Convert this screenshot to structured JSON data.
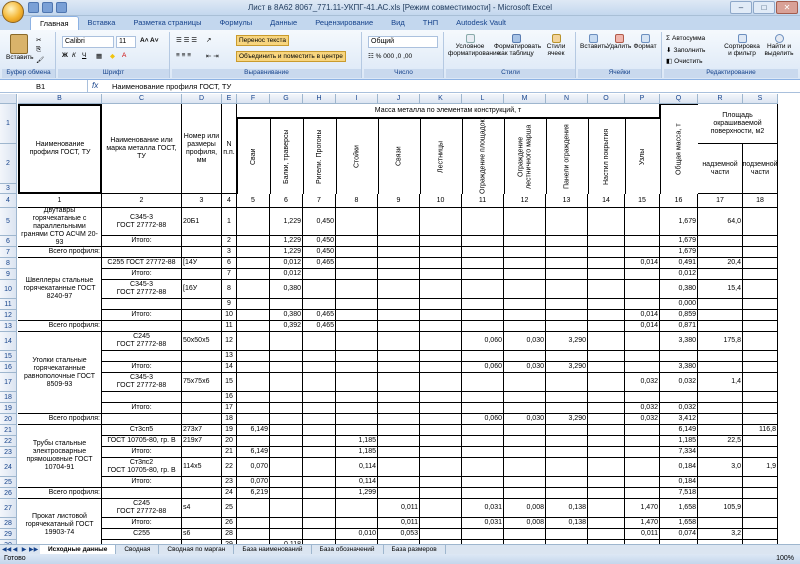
{
  "window": {
    "title": "Лист в 8А62 8067_771.11-УКПГ-41.АС.xls [Режим совместимости] - Microsoft Excel"
  },
  "ribbon": {
    "tabs": [
      "Главная",
      "Вставка",
      "Разметка страницы",
      "Формулы",
      "Данные",
      "Рецензирование",
      "Вид",
      "ТНП",
      "Autodesk Vault"
    ],
    "clipboard": {
      "paste": "Вставить",
      "group": "Буфер обмена"
    },
    "font": {
      "name": "Calibri",
      "size": "11",
      "group": "Шрифт"
    },
    "alignment": {
      "wrap": "Перенос текста",
      "merge": "Объединить и поместить в центре",
      "group": "Выравнивание"
    },
    "number": {
      "format": "Общий",
      "group": "Число"
    },
    "styles": {
      "cond": "Условное форматирование",
      "astable": "Форматировать как таблицу",
      "cellstyles": "Стили ячеек",
      "group": "Стили"
    },
    "cells": {
      "insert": "Вставить",
      "delete": "Удалить",
      "format": "Формат",
      "group": "Ячейки"
    },
    "editing": {
      "autosum": "Автосумма",
      "fill": "Заполнить",
      "clear": "Очистить",
      "sort": "Сортировка и фильтр",
      "find": "Найти и выделить",
      "group": "Редактирование"
    }
  },
  "formula_bar": {
    "name_box": "B1",
    "fx": "fx",
    "value": "Наименование профиля ГОСТ, ТУ"
  },
  "sheet": {
    "columns": [
      "B",
      "C",
      "D",
      "E",
      "F",
      "G",
      "H",
      "I",
      "J",
      "K",
      "L",
      "M",
      "N",
      "O",
      "P",
      "Q",
      "R",
      "S"
    ],
    "header": {
      "name": "Наименование профиля ГОСТ, ТУ",
      "brand": "Наименование или марка металла ГОСТ, ТУ",
      "size": "Номер или размеры профиля, мм",
      "num": "N п.п.",
      "mass_title": "Масса металла по элементам конструкций, т",
      "elements": [
        "Сваи",
        "Балки, траверсы",
        "Ригели. Прогоны",
        "Стойки",
        "Связи",
        "Лестницы",
        "Ограждение площадок",
        "Ограждение лестничного марша",
        "Панели ограждения",
        "Настил покрытия",
        "Узлы"
      ],
      "total": "Общая масса, т",
      "paint": "Площадь окрашиваемой поверхности, м2",
      "paint_above": "надземной части",
      "paint_under": "подземной части"
    },
    "colnums": [
      "1",
      "2",
      "3",
      "4",
      "5",
      "6",
      "7",
      "8",
      "9",
      "10",
      "11",
      "12",
      "13",
      "14",
      "15",
      "16",
      "17",
      "18"
    ],
    "rows": [
      {
        "r": "5",
        "b": "",
        "c": "С345-3\nГОСТ 27772-88",
        "d": "20Б1",
        "e": "1",
        "v": [
          "",
          "1,229",
          "0,450",
          "",
          "",
          "",
          "",
          "",
          "",
          "",
          "",
          "1,679",
          "64,0",
          ""
        ]
      },
      {
        "r": "6",
        "b": "",
        "c": "Итого:",
        "d": "",
        "e": "2",
        "v": [
          "",
          "1,229",
          "0,450",
          "",
          "",
          "",
          "",
          "",
          "",
          "",
          "",
          "1,679",
          "",
          ""
        ]
      },
      {
        "r": "7",
        "b": "Всего профиля:",
        "c": "",
        "d": "",
        "e": "3",
        "v": [
          "",
          "1,229",
          "0,450",
          "",
          "",
          "",
          "",
          "",
          "",
          "",
          "",
          "1,679",
          "",
          ""
        ]
      },
      {
        "r": "8",
        "b": "",
        "c": "С255 ГОСТ 27772-88",
        "d": "[14У",
        "e": "6",
        "v": [
          "",
          "0,012",
          "0,465",
          "",
          "",
          "",
          "",
          "",
          "",
          "",
          "0,014",
          "0,491",
          "20,4",
          ""
        ]
      },
      {
        "r": "9",
        "b": "",
        "c": "Итого:",
        "d": "",
        "e": "7",
        "v": [
          "",
          "0,012",
          "",
          "",
          "",
          "",
          "",
          "",
          "",
          "",
          "",
          "0,012",
          "",
          ""
        ]
      },
      {
        "r": "10",
        "b": "",
        "c": "С345-3\nГОСТ 27772-88",
        "d": "[16У",
        "e": "8",
        "v": [
          "",
          "0,380",
          "",
          "",
          "",
          "",
          "",
          "",
          "",
          "",
          "",
          "0,380",
          "15,4",
          ""
        ]
      },
      {
        "r": "11",
        "b": "",
        "c": "",
        "d": "",
        "e": "9",
        "v": [
          "",
          "",
          "",
          "",
          "",
          "",
          "",
          "",
          "",
          "",
          "",
          "0,000",
          "",
          ""
        ]
      },
      {
        "r": "12",
        "b": "",
        "c": "Итого:",
        "d": "",
        "e": "10",
        "v": [
          "",
          "0,380",
          "0,465",
          "",
          "",
          "",
          "",
          "",
          "",
          "",
          "0,014",
          "0,859",
          "",
          ""
        ]
      },
      {
        "r": "13",
        "b": "Всего профиля:",
        "c": "",
        "d": "",
        "e": "11",
        "v": [
          "",
          "0,392",
          "0,465",
          "",
          "",
          "",
          "",
          "",
          "",
          "",
          "0,014",
          "0,871",
          "",
          ""
        ]
      },
      {
        "r": "14",
        "b": "",
        "c": "С245\nГОСТ 27772-88",
        "d": "50х50х5",
        "e": "12",
        "v": [
          "",
          "",
          "",
          "",
          "",
          "",
          "0,060",
          "0,030",
          "3,290",
          "",
          "",
          "3,380",
          "175,8",
          ""
        ]
      },
      {
        "r": "15",
        "b": "",
        "c": "",
        "d": "",
        "e": "13",
        "v": [
          "",
          "",
          "",
          "",
          "",
          "",
          "",
          "",
          "",
          "",
          "",
          "",
          "",
          ""
        ]
      },
      {
        "r": "16",
        "b": "",
        "c": "Итого:",
        "d": "",
        "e": "14",
        "v": [
          "",
          "",
          "",
          "",
          "",
          "",
          "0,060",
          "0,030",
          "3,290",
          "",
          "",
          "3,380",
          "",
          ""
        ]
      },
      {
        "r": "17",
        "b": "",
        "c": "С345-3\nГОСТ 27772-88",
        "d": "75х75х6",
        "e": "15",
        "v": [
          "",
          "",
          "",
          "",
          "",
          "",
          "",
          "",
          "",
          "",
          "0,032",
          "0,032",
          "1,4",
          ""
        ]
      },
      {
        "r": "18",
        "b": "",
        "c": "",
        "d": "",
        "e": "16",
        "v": [
          "",
          "",
          "",
          "",
          "",
          "",
          "",
          "",
          "",
          "",
          "",
          "",
          "",
          ""
        ]
      },
      {
        "r": "19",
        "b": "",
        "c": "Итого:",
        "d": "",
        "e": "17",
        "v": [
          "",
          "",
          "",
          "",
          "",
          "",
          "",
          "",
          "",
          "",
          "0,032",
          "0,032",
          "",
          ""
        ]
      },
      {
        "r": "20",
        "b": "Всего профиля:",
        "c": "",
        "d": "",
        "e": "18",
        "v": [
          "",
          "",
          "",
          "",
          "",
          "",
          "0,060",
          "0,030",
          "3,290",
          "",
          "0,032",
          "3,412",
          "",
          ""
        ]
      },
      {
        "r": "21",
        "b": "",
        "c": "Ст3сп5",
        "d": "273х7",
        "e": "19",
        "v": [
          "6,149",
          "",
          "",
          "",
          "",
          "",
          "",
          "",
          "",
          "",
          "",
          "6,149",
          "",
          "116,8"
        ]
      },
      {
        "r": "22",
        "b": "",
        "c": "ГОСТ 10705-80, гр. В",
        "d": "219х7",
        "e": "20",
        "v": [
          "",
          "",
          "",
          "1,185",
          "",
          "",
          "",
          "",
          "",
          "",
          "",
          "1,185",
          "22,5",
          ""
        ]
      },
      {
        "r": "23",
        "b": "",
        "c": "Итого:",
        "d": "",
        "e": "21",
        "v": [
          "6,149",
          "",
          "",
          "1,185",
          "",
          "",
          "",
          "",
          "",
          "",
          "",
          "7,334",
          "",
          ""
        ]
      },
      {
        "r": "24",
        "b": "",
        "c": "Ст3пс2\nГОСТ 10705-80, гр. В",
        "d": "114х5",
        "e": "22",
        "v": [
          "0,070",
          "",
          "",
          "0,114",
          "",
          "",
          "",
          "",
          "",
          "",
          "",
          "0,184",
          "3,0",
          "1,9"
        ]
      },
      {
        "r": "25",
        "b": "",
        "c": "Итого:",
        "d": "",
        "e": "23",
        "v": [
          "0,070",
          "",
          "",
          "0,114",
          "",
          "",
          "",
          "",
          "",
          "",
          "",
          "0,184",
          "",
          ""
        ]
      },
      {
        "r": "26",
        "b": "Всего профиля:",
        "c": "",
        "d": "",
        "e": "24",
        "v": [
          "6,219",
          "",
          "",
          "1,299",
          "",
          "",
          "",
          "",
          "",
          "",
          "",
          "7,518",
          "",
          ""
        ]
      },
      {
        "r": "27",
        "b": "",
        "c": "С245\nГОСТ 27772-88",
        "d": "s4",
        "e": "25",
        "v": [
          "",
          "",
          "",
          "",
          "0,011",
          "",
          "0,031",
          "0,008",
          "0,138",
          "",
          "1,470",
          "1,658",
          "105,9",
          ""
        ]
      },
      {
        "r": "28",
        "b": "",
        "c": "Итого:",
        "d": "",
        "e": "26",
        "v": [
          "",
          "",
          "",
          "",
          "0,011",
          "",
          "0,031",
          "0,008",
          "0,138",
          "",
          "1,470",
          "1,658",
          "",
          ""
        ]
      },
      {
        "r": "29",
        "b": "",
        "c": "С255",
        "d": "s6",
        "e": "28",
        "v": [
          "",
          "",
          "",
          "0,010",
          "0,053",
          "",
          "",
          "",
          "",
          "",
          "0,011",
          "0,074",
          "3,2",
          ""
        ]
      },
      {
        "r": "30",
        "b": "",
        "c": "",
        "d": "",
        "e": "29",
        "v": [
          "",
          "0,118",
          "",
          "",
          "",
          "",
          "",
          "",
          "",
          "",
          "",
          "",
          "",
          ""
        ]
      }
    ],
    "merged_b": [
      {
        "text": "Двутавры горячекатаные с параллельными гранями СТО АСЧМ 20-93",
        "rows": "5-6"
      },
      {
        "text": "Швеллеры стальные горячекатанные ГОСТ 8240-97",
        "rows": "8-12"
      },
      {
        "text": "Уголки стальные горячекатанные равнополочные ГОСТ 8509-93",
        "rows": "14-19"
      },
      {
        "text": "Трубы стальные электросварные прямошовные ГОСТ 10704-91",
        "rows": "21-25"
      },
      {
        "text": "Прокат листовой горячекатаный ГОСТ 19903-74",
        "rows": "27-30"
      }
    ]
  },
  "sheet_tabs": [
    "Исходные данные",
    "Сводная",
    "Сводная по марган",
    "База наименований",
    "База обозначений",
    "База размеров"
  ],
  "status": {
    "left": "Готово",
    "zoom": "100%"
  }
}
